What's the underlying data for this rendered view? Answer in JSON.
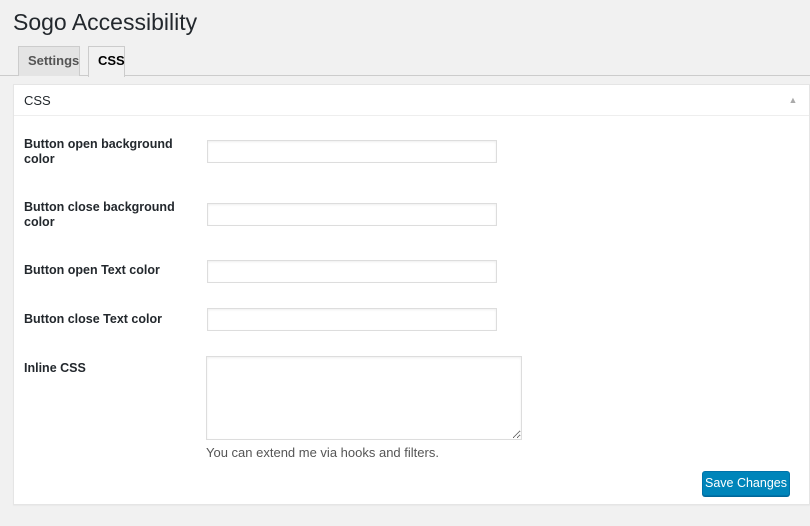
{
  "page": {
    "title": "Sogo Accessibility"
  },
  "tabs": [
    {
      "label": "Settings",
      "active": false
    },
    {
      "label": "CSS",
      "active": true
    }
  ],
  "panel": {
    "title": "CSS",
    "toggle_icon": "triangle-up-icon",
    "fields": [
      {
        "label": "Button open background color",
        "value": "",
        "type": "text"
      },
      {
        "label": "Button close background color",
        "value": "",
        "type": "text"
      },
      {
        "label": "Button open Text color",
        "value": "",
        "type": "text"
      },
      {
        "label": "Button close Text color",
        "value": "",
        "type": "text"
      },
      {
        "label": "Inline CSS",
        "value": "",
        "type": "textarea"
      }
    ],
    "description": "You can extend me via hooks and filters.",
    "save_label": "Save Changes"
  },
  "colors": {
    "background": "#f1f1f1",
    "primary_button": "#0085ba",
    "title_text": "#23282d"
  }
}
